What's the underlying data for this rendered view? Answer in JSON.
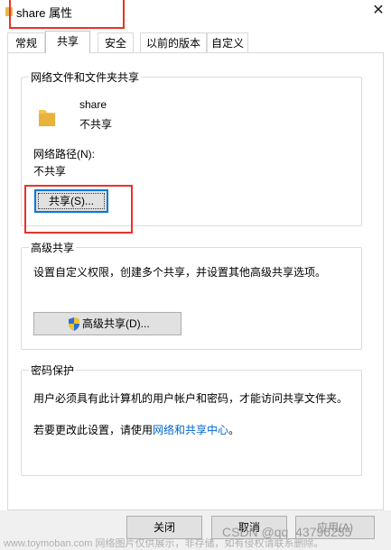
{
  "window": {
    "title": "share 属性",
    "close_glyph": "✕"
  },
  "tabs": [
    {
      "label": "常规",
      "active": false
    },
    {
      "label": "共享",
      "active": true
    },
    {
      "label": "安全",
      "active": false
    },
    {
      "label": "以前的版本",
      "active": false
    },
    {
      "label": "自定义",
      "active": false
    }
  ],
  "network_sharing": {
    "group_title": "网络文件和文件夹共享",
    "folder_name": "share",
    "share_status": "不共享",
    "path_label": "网络路径(N):",
    "path_value": "不共享",
    "share_button": "共享(S)..."
  },
  "advanced_sharing": {
    "group_title": "高级共享",
    "description": "设置自定义权限，创建多个共享，并设置其他高级共享选项。",
    "button": "高级共享(D)..."
  },
  "password_protection": {
    "group_title": "密码保护",
    "description": "用户必须具有此计算机的用户帐户和密码，才能访问共享文件夹。",
    "change_prefix": "若要更改此设置，请使用",
    "change_link": "网络和共享中心",
    "change_suffix": "。"
  },
  "buttons": {
    "close": "关闭",
    "cancel": "取消",
    "apply": "应用(A)"
  },
  "watermarks": {
    "csdn": "CSDN @qq_43796255",
    "toymoban": "www.toymoban.com 网络图片仅供展示，非存储，如有侵权请联系删除。"
  },
  "colors": {
    "highlight": "#e8332a",
    "link": "#0066cc",
    "focus": "#0078d7"
  }
}
